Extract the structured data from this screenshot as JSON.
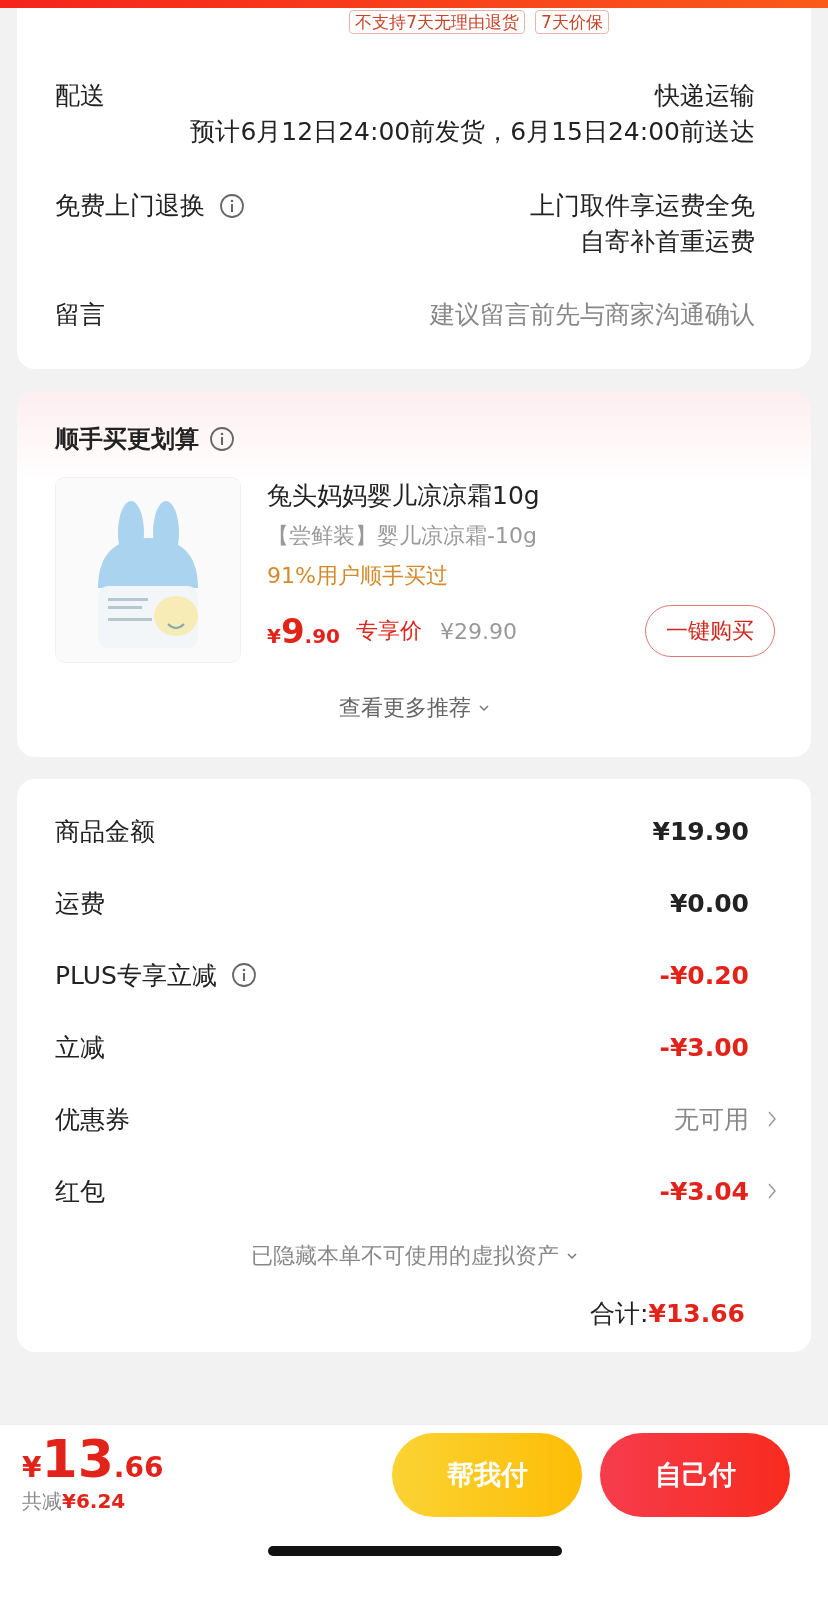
{
  "service_tags": [
    "不支持7天无理由退货",
    "7天价保"
  ],
  "delivery": {
    "label": "配送",
    "method": "快递运输",
    "estimate": "预计6月12日24:00前发货，6月15日24:00前送达"
  },
  "return_service": {
    "label": "免费上门退换",
    "lines": [
      "上门取件享运费全免",
      "自寄补首重运费"
    ]
  },
  "message": {
    "label": "留言",
    "placeholder": "建议留言前先与商家沟通确认"
  },
  "recommend": {
    "title": "顺手买更划算",
    "product": {
      "kind": "picture",
      "name": "兔头妈妈婴儿凉凉霜10g",
      "spec": "【尝鲜装】婴儿凉凉霜-10g",
      "social_proof": "91%用户顺手买过",
      "currency": "¥",
      "price_int": "9",
      "price_dec": ".90",
      "price_label": "专享价",
      "original_price": "¥29.90",
      "buy_button": "一键购买"
    },
    "more": "查看更多推荐"
  },
  "summary": {
    "rows": [
      {
        "label": "商品金额",
        "value": "¥19.90",
        "kind": "amount",
        "info": false,
        "chevron": false
      },
      {
        "label": "运费",
        "value": "¥0.00",
        "kind": "amount",
        "info": false,
        "chevron": false
      },
      {
        "label": "PLUS专享立减",
        "value": "-¥0.20",
        "kind": "deduction",
        "info": true,
        "chevron": false
      },
      {
        "label": "立减",
        "value": "-¥3.00",
        "kind": "deduction",
        "info": false,
        "chevron": false
      },
      {
        "label": "优惠券",
        "value": "无可用",
        "kind": "option",
        "info": false,
        "chevron": true
      },
      {
        "label": "红包",
        "value": "-¥3.04",
        "kind": "deduction",
        "info": false,
        "chevron": true
      }
    ],
    "hidden_assets": "已隐藏本单不可使用的虚拟资产",
    "total_label": "合计:",
    "total_value": "¥13.66"
  },
  "footer": {
    "currency": "¥",
    "price_int": "13",
    "price_dec": ".66",
    "saved_label": "共减",
    "saved_value": "¥6.24",
    "buttons": [
      {
        "label": "帮我付",
        "kind": "friend"
      },
      {
        "label": "自己付",
        "kind": "self"
      }
    ]
  }
}
